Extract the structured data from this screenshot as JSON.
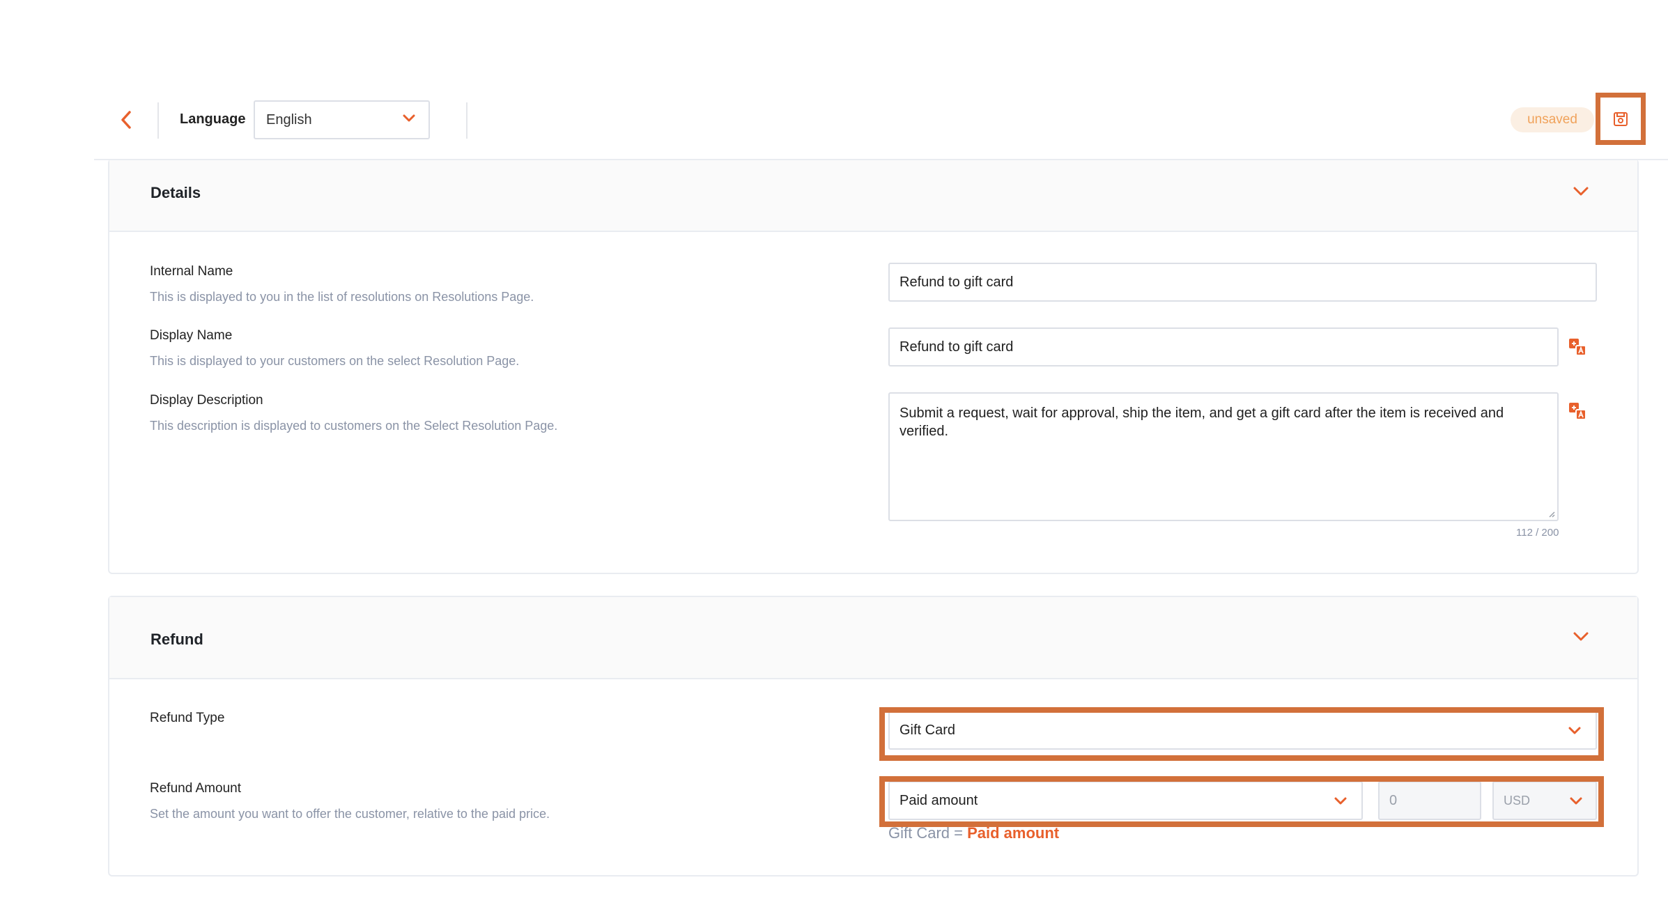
{
  "header": {
    "language_label": "Language",
    "language_value": "English",
    "status_badge": "unsaved"
  },
  "details": {
    "title": "Details",
    "internal_name": {
      "label": "Internal Name",
      "help": "This is displayed to you in the list of resolutions on Resolutions Page.",
      "value": "Refund to gift card"
    },
    "display_name": {
      "label": "Display Name",
      "help": "This is displayed to your customers on the select Resolution Page.",
      "value": "Refund to gift card"
    },
    "display_description": {
      "label": "Display Description",
      "help": "This description is displayed to customers on the Select Resolution Page.",
      "value": "Submit a request, wait for approval, ship the item, and get a gift card after the item is received and verified.",
      "counter": "112 / 200"
    }
  },
  "refund": {
    "title": "Refund",
    "refund_type": {
      "label": "Refund Type",
      "value": "Gift Card"
    },
    "refund_amount": {
      "label": "Refund Amount",
      "help": "Set the amount you want to offer the customer, relative to the paid price.",
      "mode_value": "Paid amount",
      "amount_placeholder": "0",
      "currency_value": "USD"
    },
    "summary": {
      "prefix": "Gift Card = ",
      "value": "Paid amount"
    }
  },
  "colors": {
    "accent": "#e8602c",
    "highlight": "#d2703a",
    "badge_bg": "#fbefe3",
    "badge_text": "#f0a25a"
  }
}
